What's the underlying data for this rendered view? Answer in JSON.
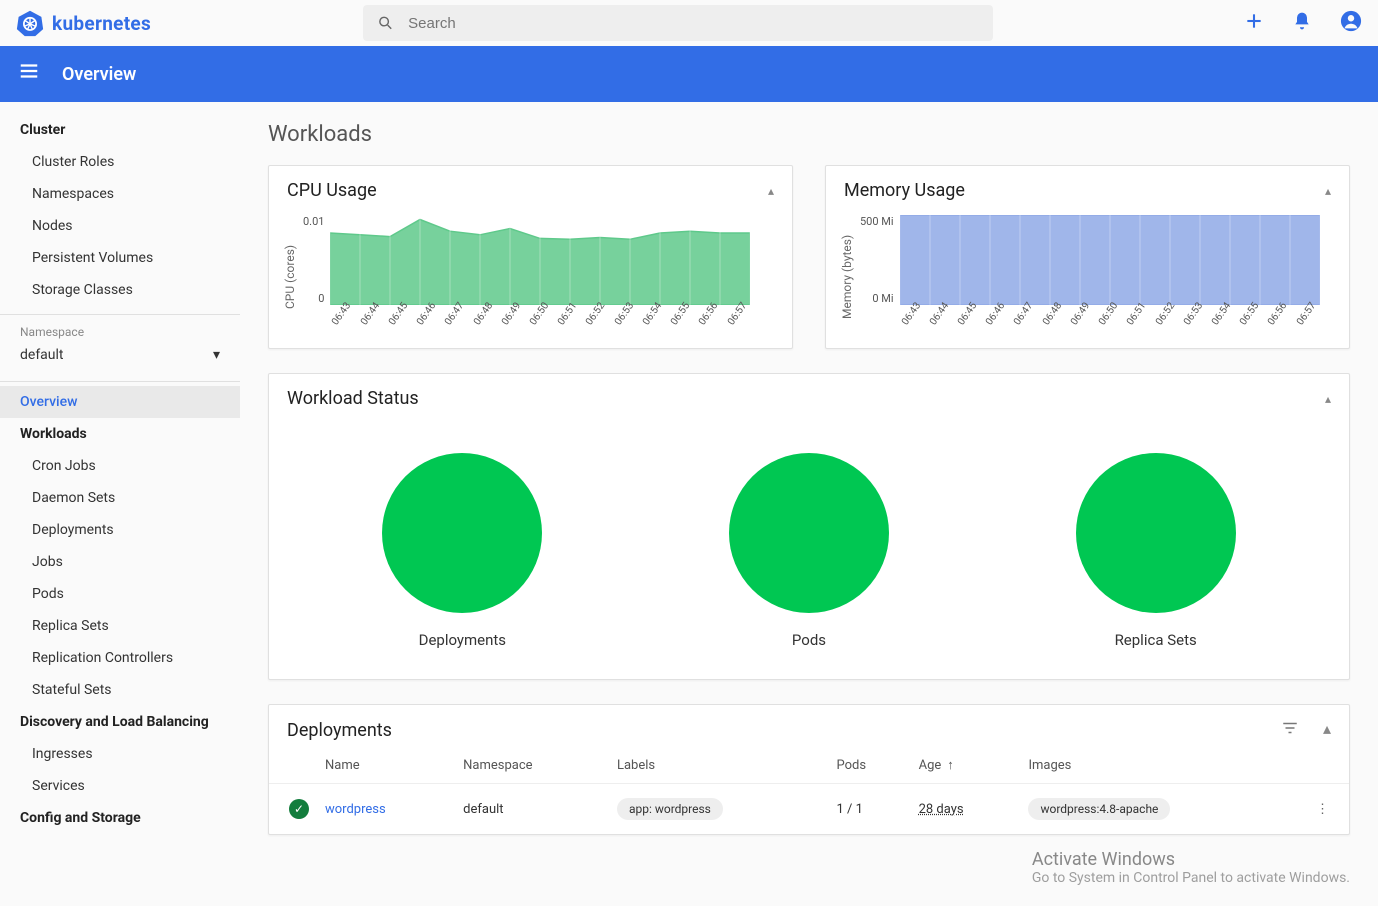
{
  "brand": "kubernetes",
  "search": {
    "placeholder": "Search"
  },
  "topIcons": {
    "add": "add-icon",
    "bell": "notifications-icon",
    "user": "account-icon"
  },
  "secondBar": {
    "title": "Overview"
  },
  "sidebar": {
    "cluster": {
      "heading": "Cluster",
      "items": [
        "Cluster Roles",
        "Namespaces",
        "Nodes",
        "Persistent Volumes",
        "Storage Classes"
      ]
    },
    "namespace": {
      "label": "Namespace",
      "selected": "default"
    },
    "overview": "Overview",
    "workloads": {
      "heading": "Workloads",
      "items": [
        "Cron Jobs",
        "Daemon Sets",
        "Deployments",
        "Jobs",
        "Pods",
        "Replica Sets",
        "Replication Controllers",
        "Stateful Sets"
      ]
    },
    "discovery": {
      "heading": "Discovery and Load Balancing",
      "items": [
        "Ingresses",
        "Services"
      ]
    },
    "config": {
      "heading": "Config and Storage"
    }
  },
  "main": {
    "sectionTitle": "Workloads",
    "cpuCard": {
      "title": "CPU Usage"
    },
    "memCard": {
      "title": "Memory Usage"
    },
    "statusCard": {
      "title": "Workload Status",
      "items": [
        "Deployments",
        "Pods",
        "Replica Sets"
      ]
    },
    "deployments": {
      "title": "Deployments",
      "columns": [
        "Name",
        "Namespace",
        "Labels",
        "Pods",
        "Age",
        "Images"
      ],
      "rows": [
        {
          "name": "wordpress",
          "namespace": "default",
          "label": "app: wordpress",
          "pods": "1 / 1",
          "age": "28 days",
          "image": "wordpress:4.8-apache"
        }
      ]
    }
  },
  "watermark": {
    "line1": "Activate Windows",
    "line2": "Go to System in Control Panel to activate Windows."
  },
  "chart_data": [
    {
      "type": "area",
      "title": "CPU Usage",
      "ylabel": "CPU (cores)",
      "ylim": [
        0,
        0.01
      ],
      "yticks": [
        0.01,
        0
      ],
      "x": [
        "06:43",
        "06:44",
        "06:45",
        "06:46",
        "06:47",
        "06:48",
        "06:49",
        "06:50",
        "06:51",
        "06:52",
        "06:53",
        "06:54",
        "06:55",
        "06:56",
        "06:57"
      ],
      "series": [
        {
          "name": "cpu",
          "color": "#5fc98b",
          "values": [
            0.008,
            0.0078,
            0.0076,
            0.0095,
            0.0082,
            0.0078,
            0.0085,
            0.0074,
            0.0073,
            0.0075,
            0.0073,
            0.008,
            0.0082,
            0.008,
            0.008
          ]
        }
      ]
    },
    {
      "type": "area",
      "title": "Memory Usage",
      "ylabel": "Memory (bytes)",
      "ylim": [
        0,
        500
      ],
      "yticks": [
        "500 Mi",
        "0 Mi"
      ],
      "x": [
        "06:43",
        "06:44",
        "06:45",
        "06:46",
        "06:47",
        "06:48",
        "06:49",
        "06:50",
        "06:51",
        "06:52",
        "06:53",
        "06:54",
        "06:55",
        "06:56",
        "06:57"
      ],
      "series": [
        {
          "name": "memory",
          "color": "#8fa9e6",
          "values": [
            500,
            500,
            500,
            500,
            500,
            500,
            500,
            500,
            500,
            500,
            500,
            500,
            500,
            500,
            500
          ]
        }
      ]
    }
  ]
}
